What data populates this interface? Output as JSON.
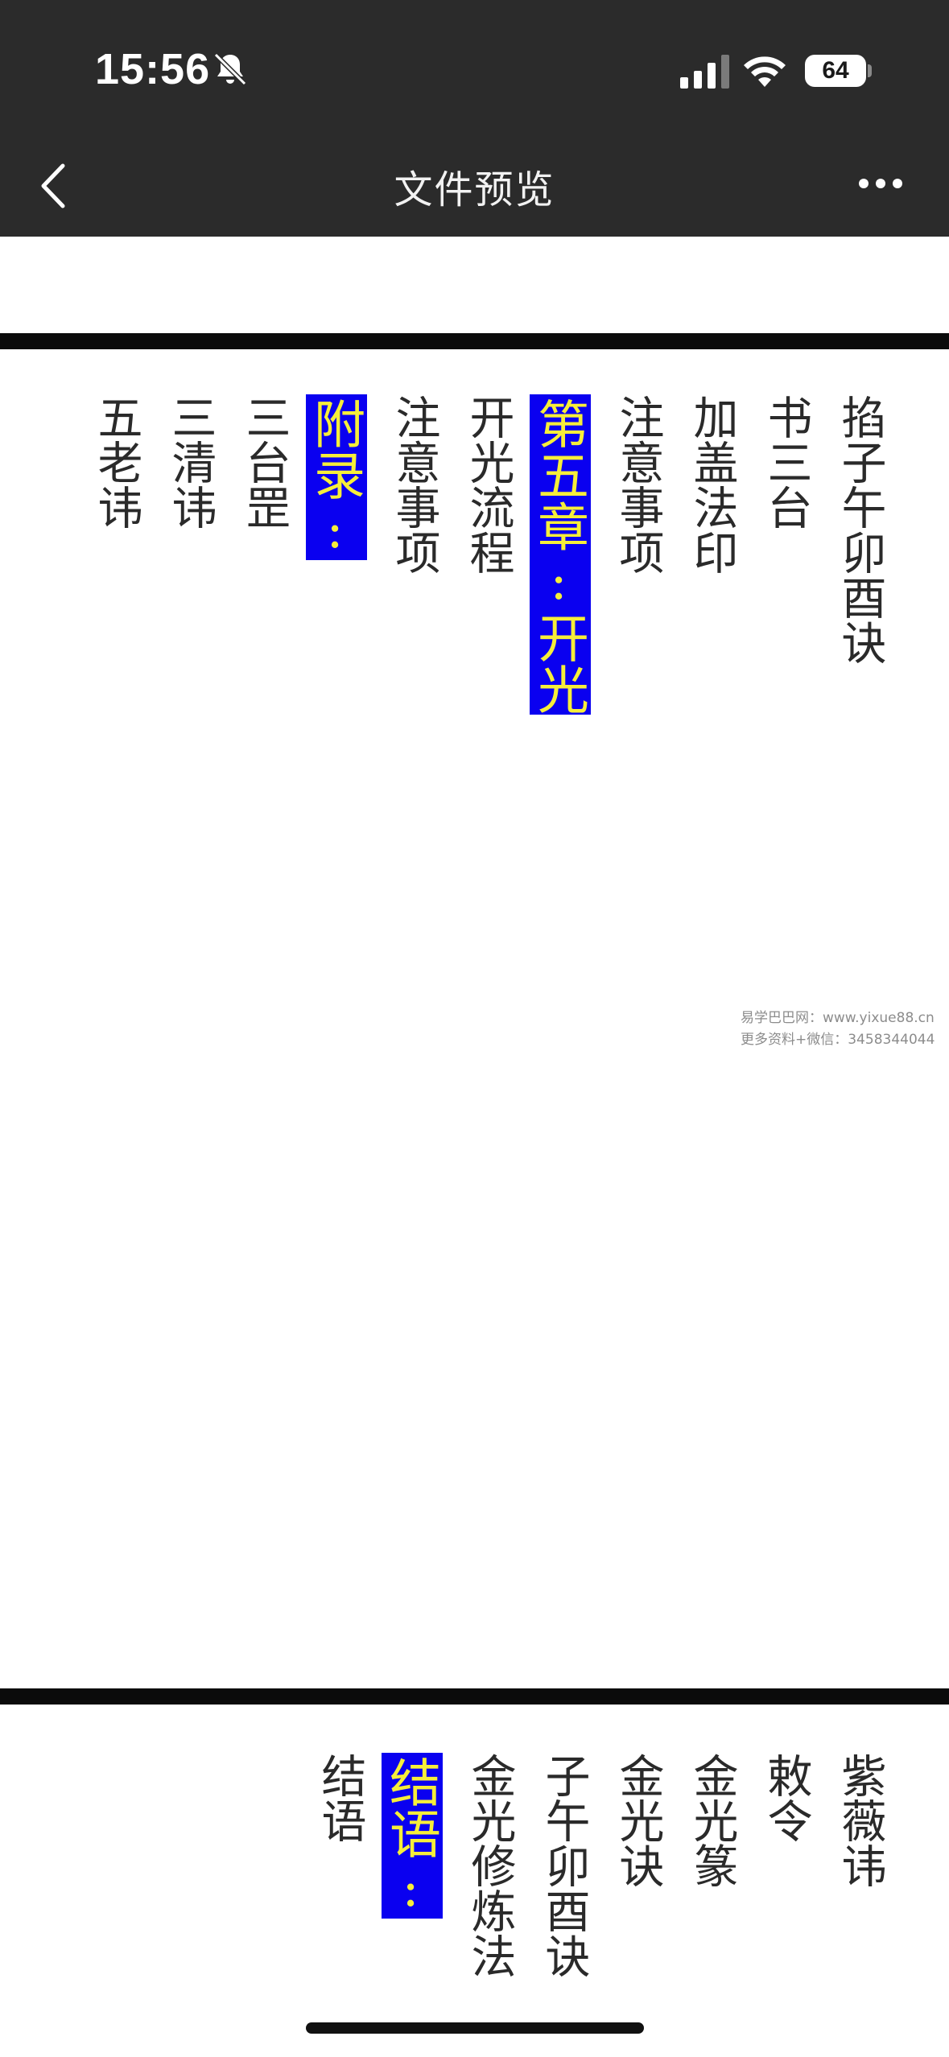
{
  "status_bar": {
    "time": "15:56",
    "battery": "64",
    "icons": [
      "bell-slash-icon",
      "cellular-signal-icon",
      "wifi-icon",
      "battery-icon"
    ]
  },
  "nav": {
    "title": "文件预览",
    "back_icon": "chevron-left-icon",
    "more_icon": "more-horizontal-icon"
  },
  "page1": {
    "columns": [
      {
        "text": "掐子午卯酉诀",
        "highlight": false
      },
      {
        "text": "书三台",
        "highlight": false
      },
      {
        "text": "加盖法印",
        "highlight": false
      },
      {
        "text": "注意事项",
        "highlight": false
      },
      {
        "text": "第五章:开光",
        "highlight": true
      },
      {
        "text": "开光流程",
        "highlight": false
      },
      {
        "text": "注意事项",
        "highlight": false
      },
      {
        "text": "附录:",
        "highlight": true
      },
      {
        "text": "三台罡",
        "highlight": false
      },
      {
        "text": "三清讳",
        "highlight": false
      },
      {
        "text": "五老讳",
        "highlight": false
      }
    ]
  },
  "page2": {
    "columns": [
      {
        "text": "紫薇讳",
        "highlight": false
      },
      {
        "text": "敕令",
        "highlight": false
      },
      {
        "text": "金光篆",
        "highlight": false
      },
      {
        "text": "金光诀",
        "highlight": false
      },
      {
        "text": "子午卯酉诀",
        "highlight": false
      },
      {
        "text": "金光修炼法",
        "highlight": false
      },
      {
        "text": "结语:",
        "highlight": true
      },
      {
        "text": "结语",
        "highlight": false
      }
    ]
  },
  "watermark": {
    "line1": "易学巴巴网：www.yixue88.cn",
    "line2": "更多资料+微信：3458344044"
  },
  "colors": {
    "bar_bg": "#2b2b2b",
    "highlight_bg": "#0a00f0",
    "highlight_text": "#f6ee3a",
    "body_text": "#2a2a2a"
  }
}
